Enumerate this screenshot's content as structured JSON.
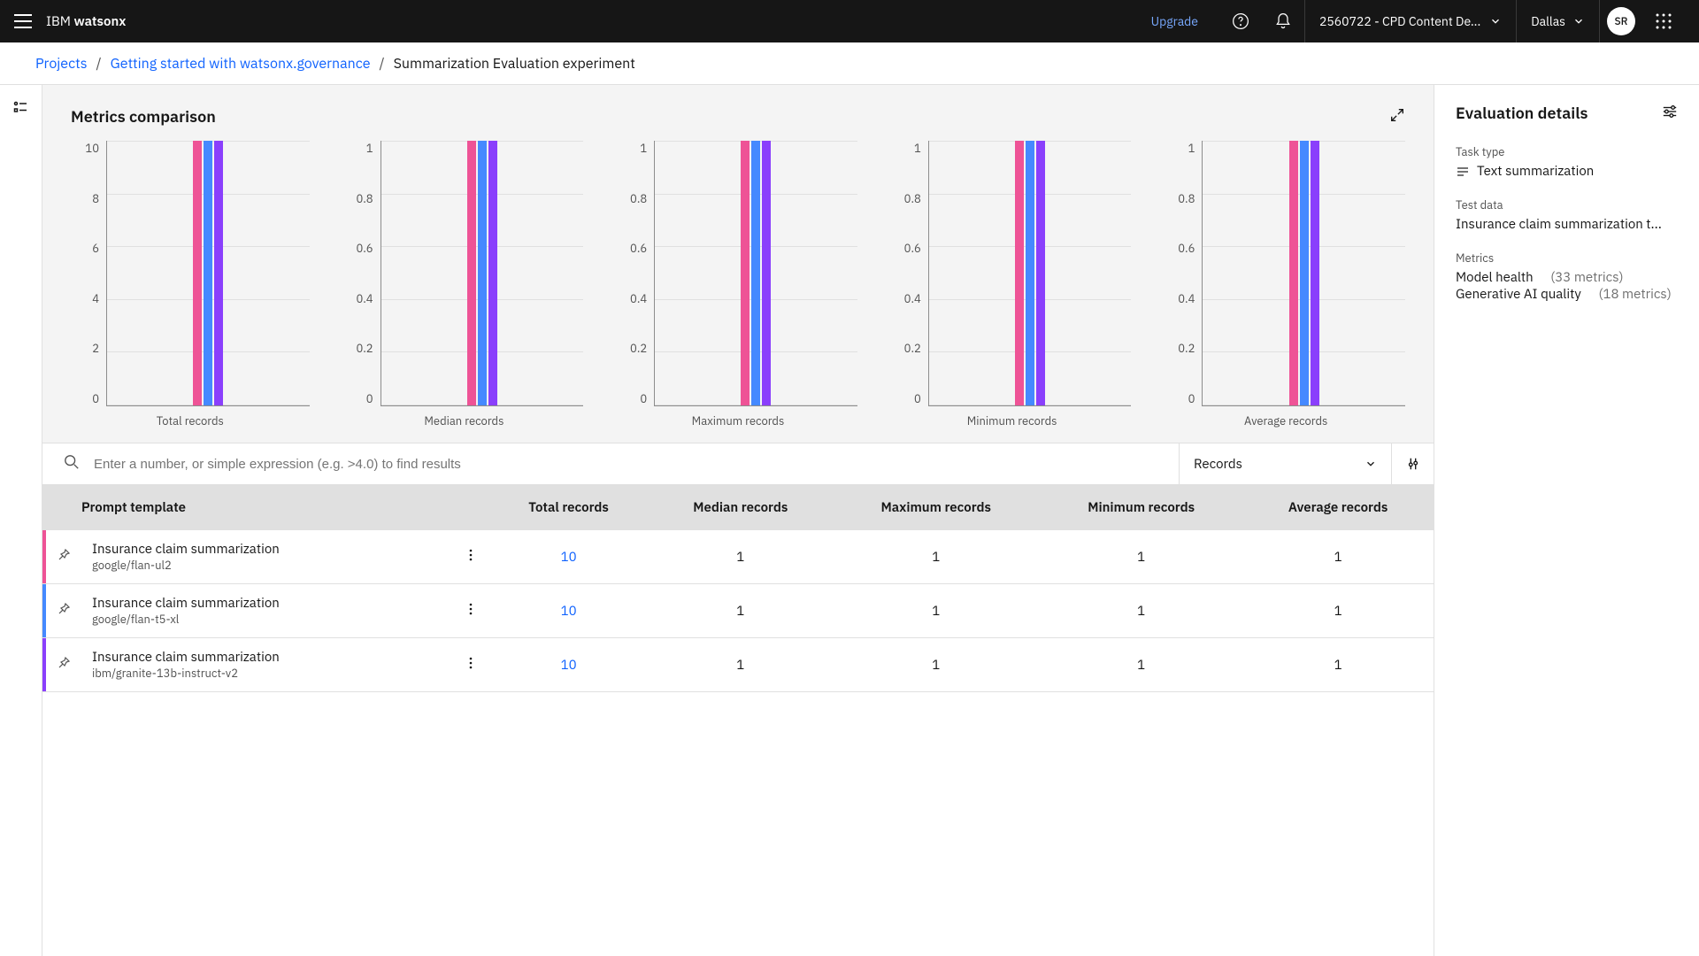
{
  "header": {
    "brand_prefix": "IBM ",
    "brand_name": "watsonx",
    "upgrade": "Upgrade",
    "account": "2560722 - CPD Content De...",
    "region": "Dallas",
    "avatar": "SR"
  },
  "breadcrumb": {
    "projects": "Projects",
    "project_name": "Getting started with watsonx.governance",
    "current": "Summarization Evaluation experiment"
  },
  "charts": {
    "title": "Metrics comparison"
  },
  "search": {
    "placeholder": "Enter a number, or simple expression (e.g. >4.0) to find results",
    "dropdown": "Records"
  },
  "table": {
    "headers": {
      "prompt": "Prompt template",
      "total": "Total records",
      "median": "Median records",
      "max": "Maximum records",
      "min": "Minimum records",
      "avg": "Average records"
    },
    "rows": [
      {
        "title": "Insurance claim summarization",
        "subtitle": "google/flan-ul2",
        "total": "10",
        "median": "1",
        "max": "1",
        "min": "1",
        "avg": "1"
      },
      {
        "title": "Insurance claim summarization",
        "subtitle": "google/flan-t5-xl",
        "total": "10",
        "median": "1",
        "max": "1",
        "min": "1",
        "avg": "1"
      },
      {
        "title": "Insurance claim summarization",
        "subtitle": "ibm/granite-13b-instruct-v2",
        "total": "10",
        "median": "1",
        "max": "1",
        "min": "1",
        "avg": "1"
      }
    ]
  },
  "side": {
    "title": "Evaluation details",
    "task_type_label": "Task type",
    "task_type_value": "Text summarization",
    "test_data_label": "Test data",
    "test_data_value": "Insurance claim summarization t...",
    "metrics_label": "Metrics",
    "model_health_name": "Model health",
    "model_health_count": "(33 metrics)",
    "gen_ai_name": "Generative AI quality",
    "gen_ai_count": "(18 metrics)"
  },
  "chart_data": [
    {
      "type": "bar",
      "title": "Total records",
      "ylim": [
        0,
        10
      ],
      "yticks": [
        0,
        2,
        4,
        6,
        8,
        10
      ],
      "series": [
        {
          "name": "google/flan-ul2",
          "value": 10,
          "color": "#ee5396"
        },
        {
          "name": "google/flan-t5-xl",
          "value": 10,
          "color": "#4589ff"
        },
        {
          "name": "ibm/granite-13b-instruct-v2",
          "value": 10,
          "color": "#8a3ffc"
        }
      ]
    },
    {
      "type": "bar",
      "title": "Median records",
      "ylim": [
        0,
        1
      ],
      "yticks": [
        0,
        0.2,
        0.4,
        0.6,
        0.8,
        1
      ],
      "series": [
        {
          "name": "google/flan-ul2",
          "value": 1,
          "color": "#ee5396"
        },
        {
          "name": "google/flan-t5-xl",
          "value": 1,
          "color": "#4589ff"
        },
        {
          "name": "ibm/granite-13b-instruct-v2",
          "value": 1,
          "color": "#8a3ffc"
        }
      ]
    },
    {
      "type": "bar",
      "title": "Maximum records",
      "ylim": [
        0,
        1
      ],
      "yticks": [
        0,
        0.2,
        0.4,
        0.6,
        0.8,
        1
      ],
      "series": [
        {
          "name": "google/flan-ul2",
          "value": 1,
          "color": "#ee5396"
        },
        {
          "name": "google/flan-t5-xl",
          "value": 1,
          "color": "#4589ff"
        },
        {
          "name": "ibm/granite-13b-instruct-v2",
          "value": 1,
          "color": "#8a3ffc"
        }
      ]
    },
    {
      "type": "bar",
      "title": "Minimum records",
      "ylim": [
        0,
        1
      ],
      "yticks": [
        0,
        0.2,
        0.4,
        0.6,
        0.8,
        1
      ],
      "series": [
        {
          "name": "google/flan-ul2",
          "value": 1,
          "color": "#ee5396"
        },
        {
          "name": "google/flan-t5-xl",
          "value": 1,
          "color": "#4589ff"
        },
        {
          "name": "ibm/granite-13b-instruct-v2",
          "value": 1,
          "color": "#8a3ffc"
        }
      ]
    },
    {
      "type": "bar",
      "title": "Average records",
      "ylim": [
        0,
        1
      ],
      "yticks": [
        0,
        0.2,
        0.4,
        0.6,
        0.8,
        1
      ],
      "series": [
        {
          "name": "google/flan-ul2",
          "value": 1,
          "color": "#ee5396"
        },
        {
          "name": "google/flan-t5-xl",
          "value": 1,
          "color": "#4589ff"
        },
        {
          "name": "ibm/granite-13b-instruct-v2",
          "value": 1,
          "color": "#8a3ffc"
        }
      ]
    }
  ]
}
